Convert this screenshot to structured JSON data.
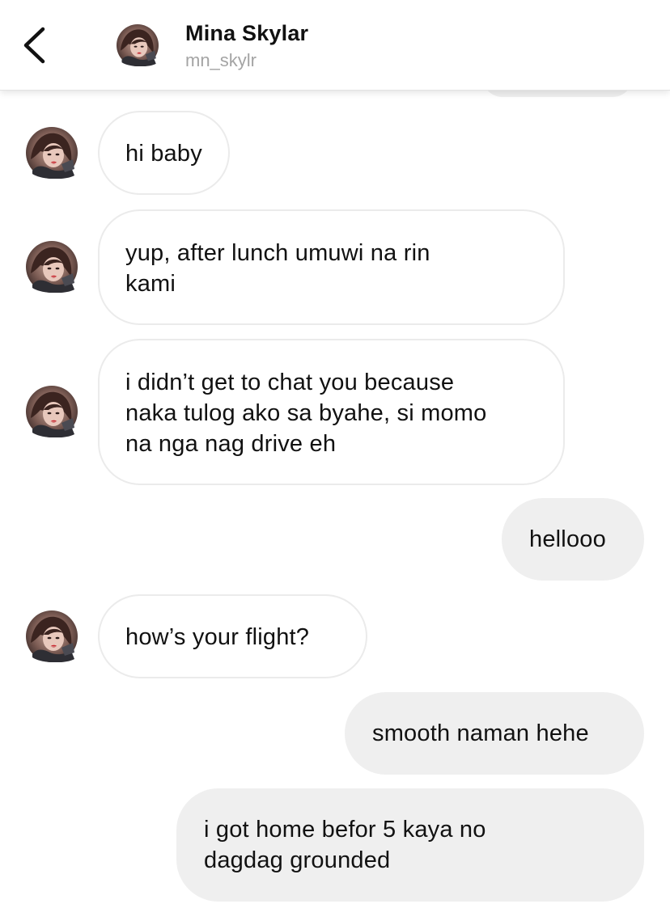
{
  "header": {
    "back_icon": "chevron-left-icon",
    "contact_name": "Mina Skylar",
    "contact_handle": "mn_skylr"
  },
  "messages": [
    {
      "direction": "incoming",
      "text": "hi baby"
    },
    {
      "direction": "incoming",
      "text": "yup, after lunch umuwi na rin\nkami"
    },
    {
      "direction": "incoming",
      "text": "i didn’t get to chat you because\nnaka tulog ako sa byahe, si momo\nna nga nag drive eh"
    },
    {
      "direction": "outgoing",
      "text": "hellooo"
    },
    {
      "direction": "incoming",
      "text": "how’s your flight?"
    },
    {
      "direction": "outgoing",
      "text": "smooth naman hehe"
    },
    {
      "direction": "outgoing",
      "text": "i got home befor 5 kaya no\ndagdag grounded"
    }
  ],
  "colors": {
    "outgoing_bubble": "#efefef",
    "incoming_border": "#ebebeb",
    "handle_text": "#a4a4a4"
  }
}
